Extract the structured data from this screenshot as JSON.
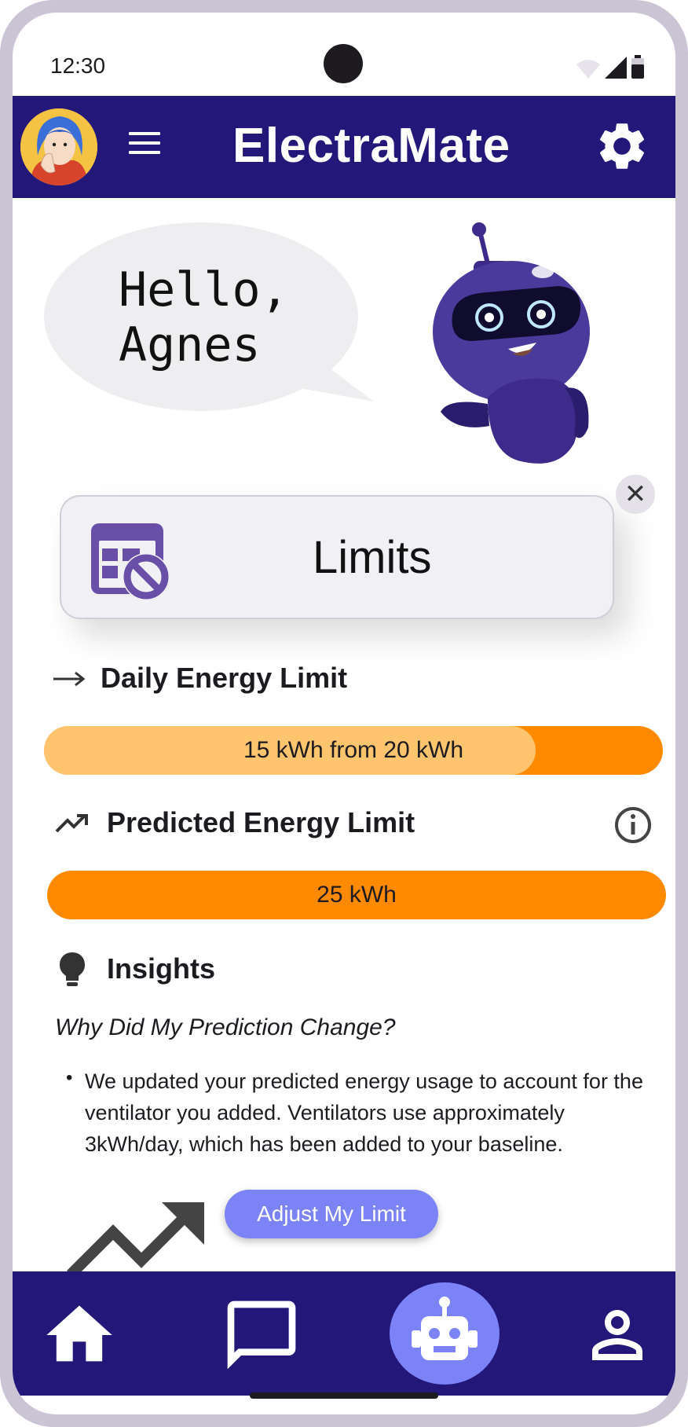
{
  "status_bar": {
    "time": "12:30"
  },
  "app_bar": {
    "title": "ElectraMate"
  },
  "greeting": {
    "text": "Hello,\nAgnes"
  },
  "limits_card": {
    "label": "Limits"
  },
  "daily_limit": {
    "heading": "Daily Energy Limit",
    "bar_text": "15 kWh from 20 kWh",
    "used_kwh": 15,
    "limit_kwh": 20
  },
  "predicted_limit": {
    "heading": "Predicted Energy Limit",
    "bar_text": "25 kWh"
  },
  "insights": {
    "heading": "Insights",
    "question": "Why Did My Prediction Change?",
    "bullet": "We updated your predicted energy usage to account for the ventilator you added. Ventilators use approximately 3kWh/day, which has been added to your baseline."
  },
  "adjust_button": {
    "label": "Adjust My Limit"
  },
  "colors": {
    "primary": "#23177a",
    "accent": "#7b83f6",
    "bar_full": "#ff8a00",
    "bar_used": "#ffc46e"
  },
  "bottom_nav": {
    "items": [
      "home-icon",
      "chat-icon",
      "robot-icon",
      "profile-icon"
    ]
  }
}
